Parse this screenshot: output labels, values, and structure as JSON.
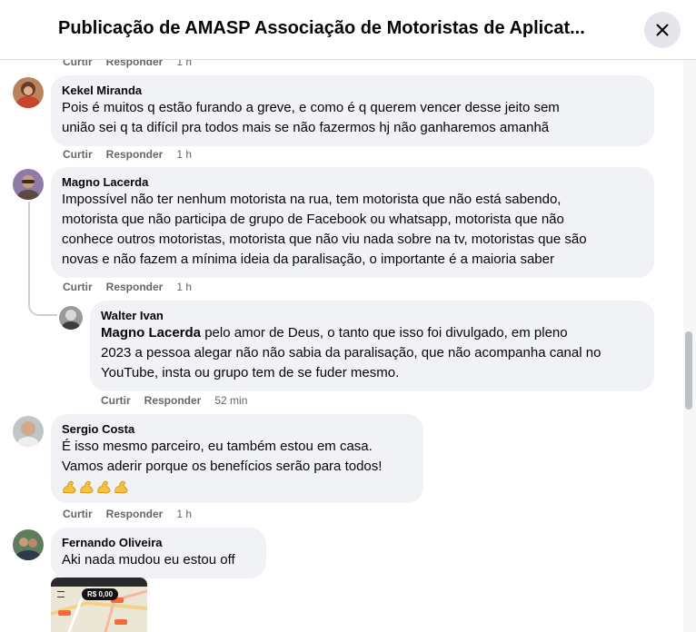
{
  "header": {
    "title": "Publicação de AMASP Associação de Motoristas de Aplicat..."
  },
  "labels": {
    "like": "Curtir",
    "reply": "Responder"
  },
  "top_partial": {
    "like": "Curtir",
    "reply": "Responder",
    "time": "1 h"
  },
  "comments": [
    {
      "author": "Kekel Miranda",
      "lines": [
        "Pois é muitos q estão furando a greve, e como é q querem vencer desse jeito sem",
        "união sei q ta difícil pra todos mais se não fazermos hj não ganharemos amanhã"
      ],
      "time": "1 h"
    },
    {
      "author": "Magno Lacerda",
      "lines": [
        "Impossível não ter nenhum motorista na rua, tem motorista que não está sabendo,",
        "motorista que não participa de grupo de Facebook ou whatsapp, motorista que não",
        "conhece outros motoristas, motorista que não viu nada sobre na tv, motoristas que são",
        "novas e não fazem a mínima ideia da paralisação, o importante é a maioria saber"
      ],
      "time": "1 h"
    },
    {
      "author": "Walter Ivan",
      "mention": "Magno Lacerda",
      "lines": [
        " pelo amor de Deus, o tanto que isso foi divulgado, em pleno",
        "2023 a pessoa alegar não não sabia da paralisação, que não acompanha canal no",
        "YouTube, insta ou grupo tem de se fuder mesmo."
      ],
      "time": "52 min"
    },
    {
      "author": "Sergio Costa",
      "lines": [
        "É isso mesmo parceiro, eu também estou em casa.",
        "Vamos aderir porque os benefícios serão para todos!"
      ],
      "emoji": [
        "flexed-biceps",
        "flexed-biceps",
        "flexed-biceps",
        "flexed-biceps"
      ],
      "time": "1 h"
    },
    {
      "author": "Fernando Oliveira",
      "lines": [
        "Aki nada mudou eu estou off"
      ]
    }
  ],
  "attachment": {
    "badge": "R$ 0,00"
  },
  "icons": {
    "close": "close-icon",
    "emoji": "flexed-biceps-emoji"
  },
  "colors": {
    "bubble": "#f0f2f5",
    "meta_text": "#65676b",
    "close_button_bg": "#e4e6eb",
    "thread_line": "#ced0d4"
  }
}
